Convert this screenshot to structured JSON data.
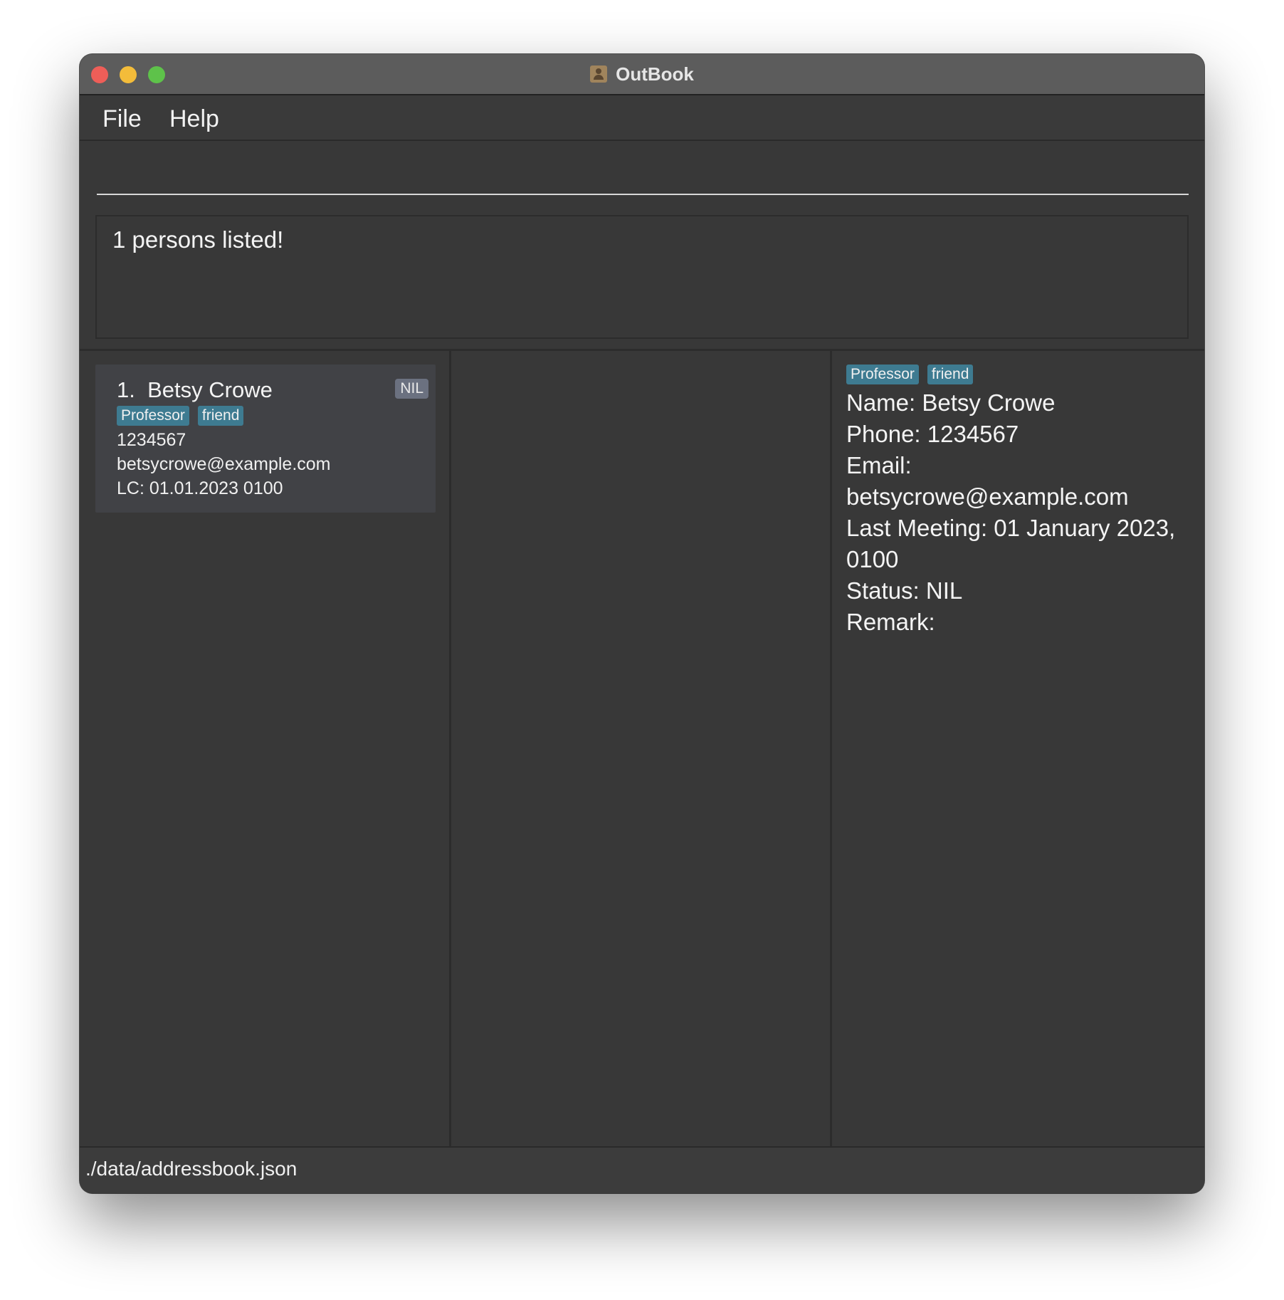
{
  "window": {
    "title": "OutBook"
  },
  "menu": {
    "file": "File",
    "help": "Help"
  },
  "command": {
    "value": ""
  },
  "result": {
    "message": "1 persons listed!"
  },
  "person_list": [
    {
      "index": "1.",
      "name": "Betsy Crowe",
      "status": "NIL",
      "tags": [
        "Professor",
        "friend"
      ],
      "phone": "1234567",
      "email": "betsycrowe@example.com",
      "last_contacted": "LC: 01.01.2023 0100"
    }
  ],
  "detail": {
    "tags": [
      "Professor",
      "friend"
    ],
    "name": "Name: Betsy Crowe",
    "phone": "Phone: 1234567",
    "email_label": "Email:",
    "email": "betsycrowe@example.com",
    "last_meeting": "Last Meeting: 01 January 2023,",
    "last_meeting_time": "0100",
    "status": "Status: NIL",
    "remark": "Remark:"
  },
  "statusbar": {
    "path": "./data/addressbook.json"
  },
  "colors": {
    "background": "#383838",
    "titlebar": "#5c5c5c",
    "tag": "#3e7b91",
    "status_badge": "#6b7180",
    "card": "#414246"
  }
}
